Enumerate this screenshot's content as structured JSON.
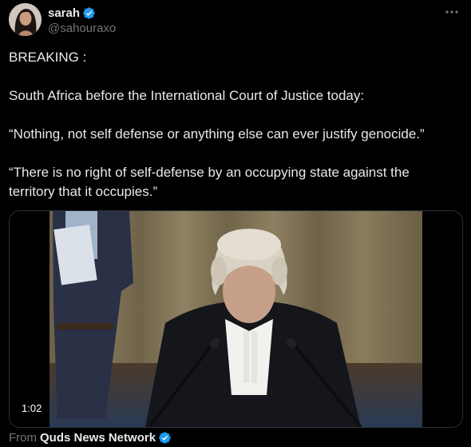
{
  "author": {
    "display_name": "sarah",
    "handle": "@sahouraxo",
    "verified": true
  },
  "icons": {
    "avatar": "profile-photo",
    "verified": "verified-badge-icon",
    "more": "more-options-icon"
  },
  "colors": {
    "background": "#000000",
    "text": "#e7e9ea",
    "secondary_text": "#71767b",
    "verified_blue": "#1d9bf0"
  },
  "tweet": {
    "paragraphs": [
      "BREAKING :",
      "South Africa before the International Court of Justice today:",
      "“Nothing, not self defense or anything else can ever justify genocide.”",
      "“There is no right of self-defense by an occupying state against the territory that it occupies.”"
    ]
  },
  "video": {
    "duration": "1:02"
  },
  "attribution": {
    "label": "From",
    "source": "Quds News Network",
    "verified": true
  }
}
